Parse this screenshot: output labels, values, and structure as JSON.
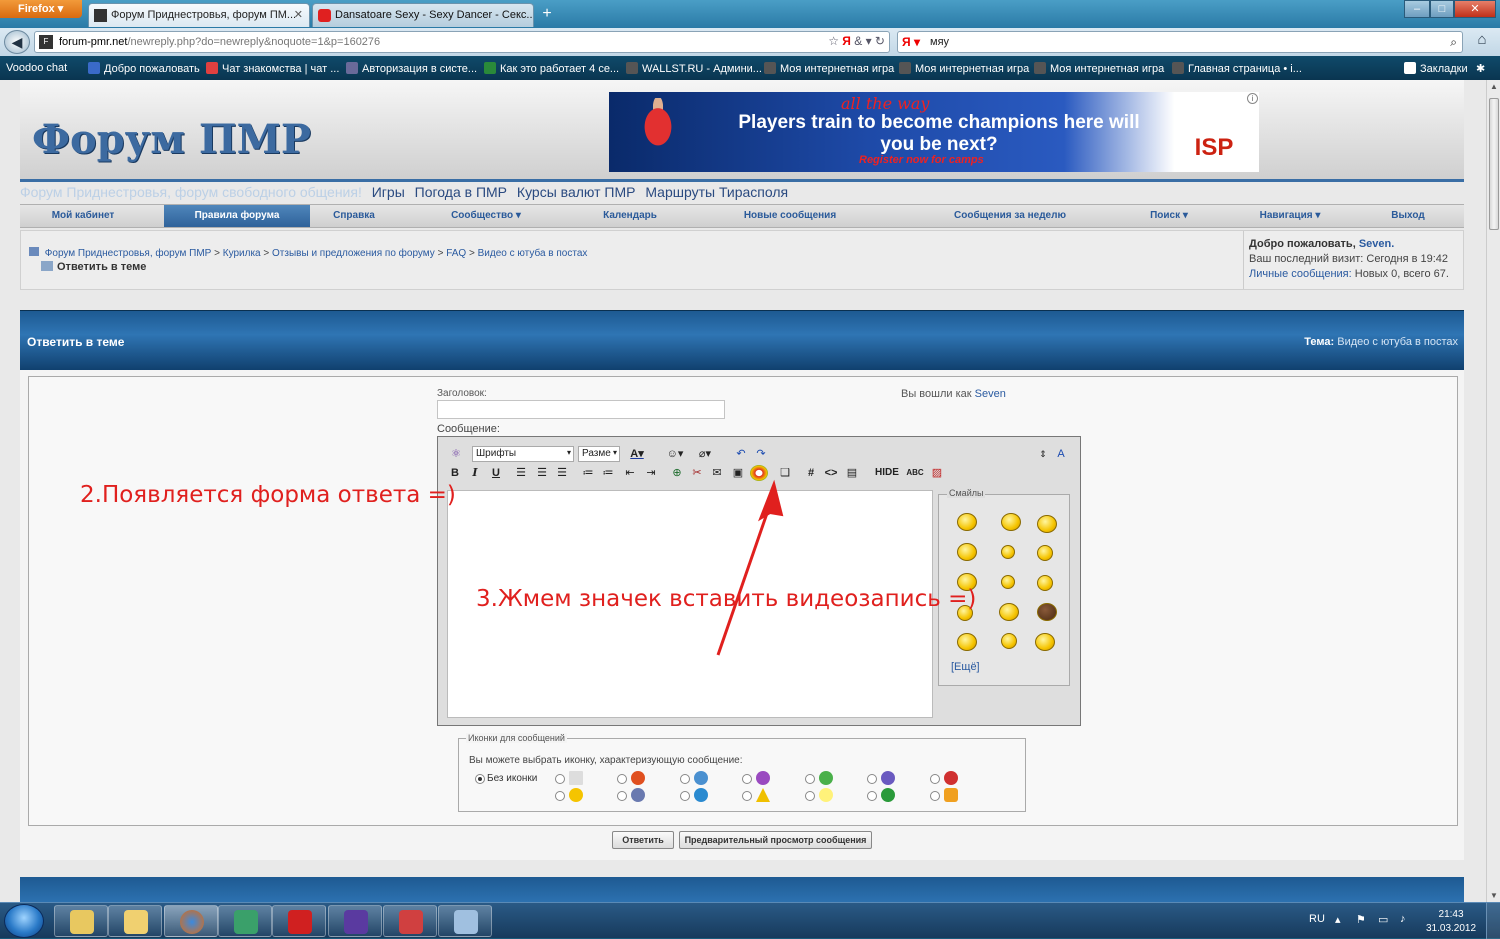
{
  "browser": {
    "menu_button": "Firefox",
    "tabs": [
      {
        "label": "Форум Приднестровья, форум ПМ...",
        "favicon": "forum-favicon"
      },
      {
        "label": "Dansatoare Sexy - Sexy Dancer - Секс...",
        "favicon": "youtube-favicon"
      }
    ],
    "new_tab": "+",
    "window_controls": [
      "–",
      "□",
      "✕"
    ],
    "url_host": "forum-pmr.net",
    "url_path": "/newreply.php?do=newreply&noquote=1&p=160276",
    "search_engine": "Я",
    "search_value": "мяу",
    "bookmarks": [
      {
        "label": "Voodoo chat",
        "color": "#3a3a3a"
      },
      {
        "label": "Добро пожаловать",
        "color": "#3a6ac8"
      },
      {
        "label": "Чат знакомства | чат ...",
        "color": "#e04040"
      },
      {
        "label": "Авторизация в систе...",
        "color": "#6a6a9a"
      },
      {
        "label": "Как это работает 4 се...",
        "color": "#2a8a3a"
      },
      {
        "label": "WALLST.RU - Админи...",
        "color": "#555555"
      },
      {
        "label": "Моя интернетная игра",
        "color": "#555555"
      },
      {
        "label": "Моя интернетная игра",
        "color": "#555555"
      },
      {
        "label": "Моя интернетная игра",
        "color": "#555555"
      },
      {
        "label": "Главная страница • i...",
        "color": "#555555"
      }
    ],
    "bookmarks_menu": "Закладки"
  },
  "forum": {
    "logo": "Форум ПМР",
    "banner": {
      "tagline": "all the way",
      "headline": "Players train to become champions here will you be next?",
      "sub": "Register now for camps",
      "logo_text": "ISP",
      "info": "i"
    },
    "top_links": [
      "Форум Приднестровья, форум свободного общения!",
      "Игры",
      "Погода в ПМР",
      "Курсы валют ПМР",
      "Маршруты Тирасполя"
    ],
    "menu": [
      "Мой кабинет",
      "Правила форума",
      "Справка",
      "Сообщество ▾",
      "Календарь",
      "Новые сообщения",
      "Сообщения за неделю",
      "Поиск ▾",
      "Навигация ▾",
      "Выход"
    ],
    "breadcrumb": [
      "Форум Приднестровья, форум ПМР",
      "Курилка",
      "Отзывы и предложения по форуму",
      "FAQ",
      "Видео с ютуба в постах"
    ],
    "breadcrumb_current": "Ответить в теме",
    "welcome": {
      "greeting": "Добро пожаловать,",
      "user": "Seven.",
      "last_visit": "Ваш последний визит: Сегодня в 19:42",
      "pm_label": "Личные сообщения:",
      "pm_value": " Новых 0, всего 67."
    },
    "reply": {
      "title": "Ответить в теме",
      "topic_label": "Тема:",
      "topic_value": " Видео с ютуба в постах",
      "title_field_label": "Заголовок:",
      "title_field_value": "",
      "logged_in_prefix": "Вы вошли как ",
      "logged_in_user": "Seven",
      "message_label": "Сообщение:",
      "font_select": "Шрифты",
      "size_select": "Разме",
      "toolbar_hide": "HIDE",
      "smilies_legend": "Смайлы",
      "smilies_more": "[Ещё]",
      "post_icons_legend": "Иконки для сообщений",
      "post_icons_hint": "Вы можете выбрать иконку, характеризующую сообщение:",
      "no_icon": "Без иконки",
      "submit": "Ответить",
      "preview": "Предварительный просмотр сообщения"
    }
  },
  "annotations": {
    "step2": "2.Появляется форма ответа =)",
    "step3": "3.Жмем значек вставить видеозапись =)"
  },
  "taskbar": {
    "language": "RU",
    "time": "21:43",
    "date": "31.03.2012"
  }
}
